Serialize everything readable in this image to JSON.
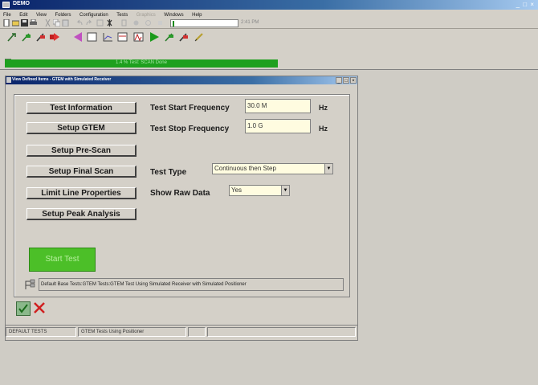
{
  "app": {
    "title": "DEMO",
    "window_controls": "_ □ ×"
  },
  "menu": [
    {
      "label": "File",
      "disabled": false
    },
    {
      "label": "Edit",
      "disabled": false
    },
    {
      "label": "View",
      "disabled": false
    },
    {
      "label": "Folders",
      "disabled": false
    },
    {
      "label": "Configuration",
      "disabled": false
    },
    {
      "label": "Tests",
      "disabled": false
    },
    {
      "label": "Graphics",
      "disabled": true
    },
    {
      "label": "Windows",
      "disabled": false
    },
    {
      "label": "Help",
      "disabled": false
    }
  ],
  "toolbar": {
    "status_text": "2:41 PM"
  },
  "progress": {
    "text": "1.4 %  Test: SCAN Done",
    "fraction": 1.0
  },
  "child_window": {
    "title": "View Defined Items - GTEM with Simulated Receiver"
  },
  "buttons": {
    "test_information": "Test Information",
    "setup_gtem": "Setup GTEM",
    "setup_prescan": "Setup Pre-Scan",
    "setup_final_scan": "Setup Final Scan",
    "limit_line_properties": "Limit Line Properties",
    "setup_peak_analysis": "Setup Peak Analysis",
    "start_test": "Start Test"
  },
  "fields": {
    "start_freq_label": "Test Start Frequency",
    "start_freq_value": "30.0 M",
    "start_freq_unit": "Hz",
    "stop_freq_label": "Test Stop Frequency",
    "stop_freq_value": "1.0 G",
    "stop_freq_unit": "Hz",
    "test_type_label": "Test Type",
    "test_type_value": "Continuous then Step",
    "show_raw_label": "Show Raw Data",
    "show_raw_value": "Yes"
  },
  "path": "Default Base Tests:GTEM Tests:GTEM Test Using Simulated Receiver with Simulated Positioner",
  "statusbar": {
    "cell1": "DEFAULT TESTS",
    "cell2": "GTEM Tests Using Positioner",
    "cell3": ""
  },
  "colors": {
    "start_button": "#4cbf28",
    "progress": "#1ea01e",
    "field_bg": "#fffce0",
    "titlebar": "#0a246a"
  }
}
